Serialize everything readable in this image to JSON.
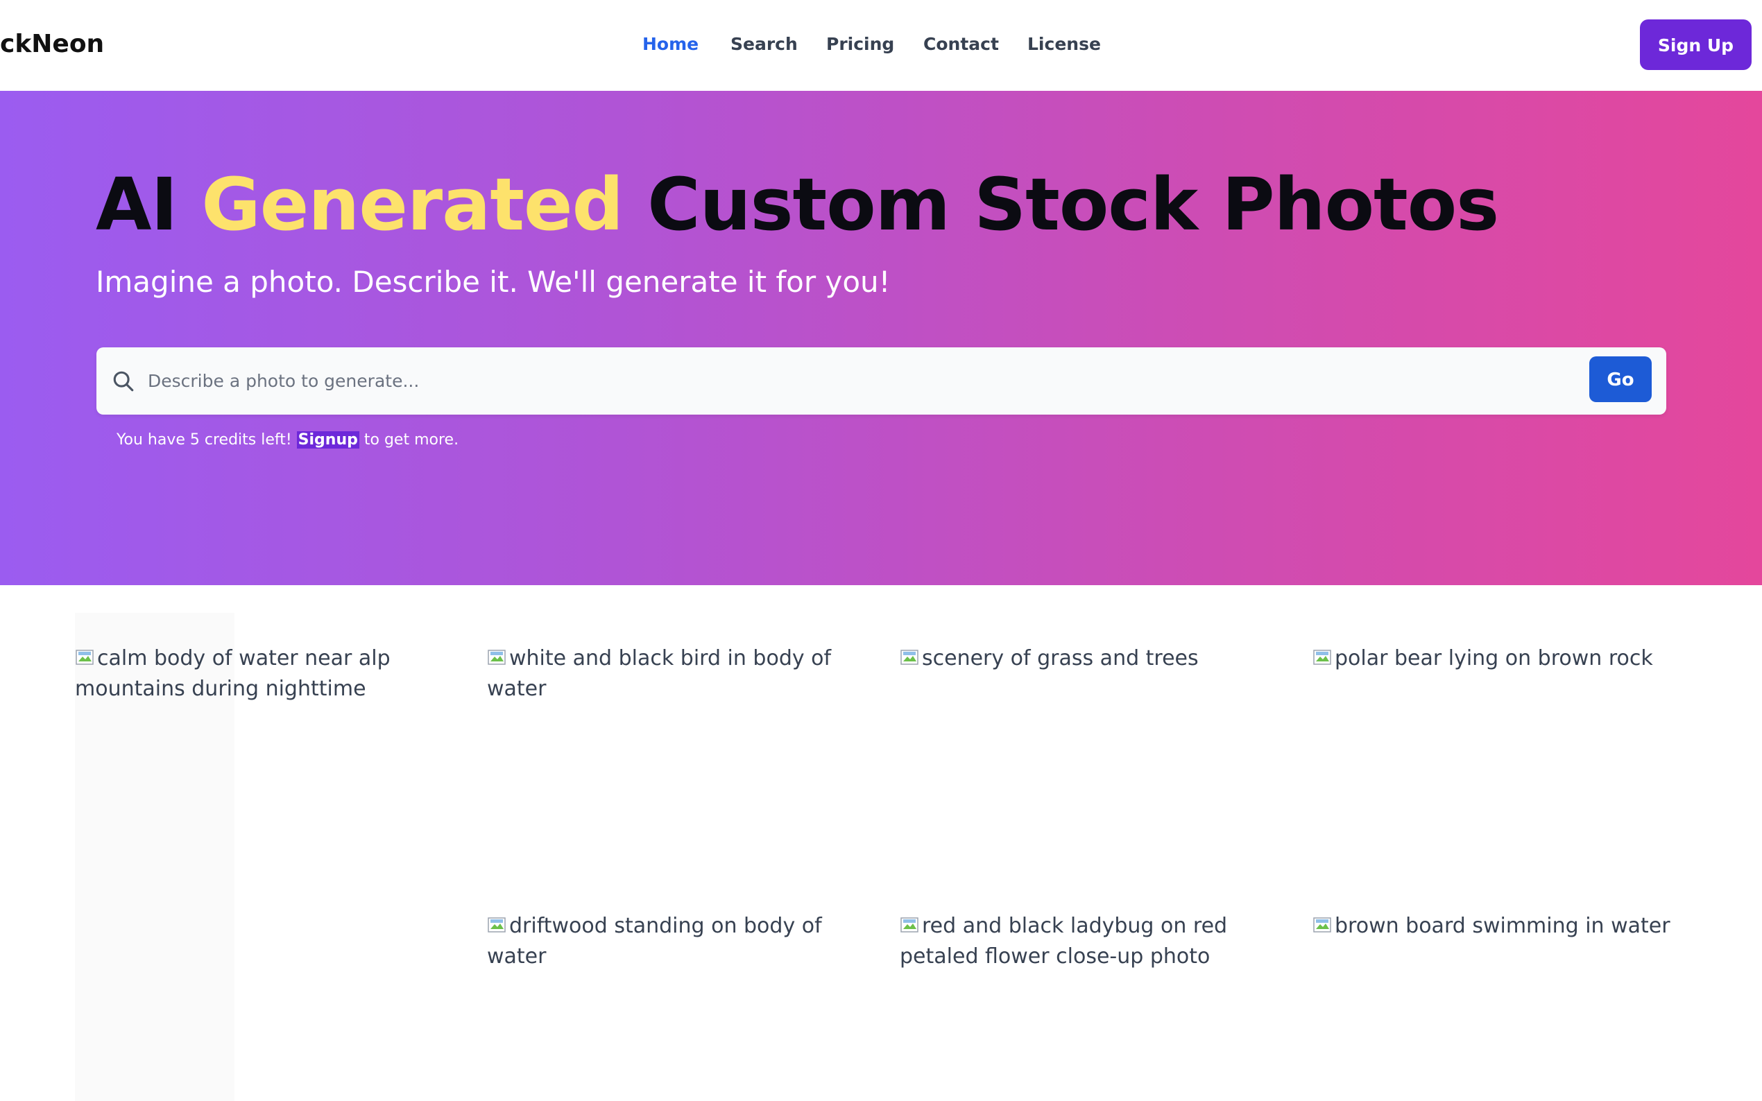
{
  "header": {
    "brand": "ckNeon",
    "nav": [
      {
        "label": "Home",
        "active": true
      },
      {
        "label": "Search",
        "active": false
      },
      {
        "label": "Pricing",
        "active": false
      },
      {
        "label": "Contact",
        "active": false
      },
      {
        "label": "License",
        "active": false
      }
    ],
    "signup_label": "Sign Up"
  },
  "hero": {
    "title_part1": "AI ",
    "title_accent": "Generated",
    "title_part2": " Custom Stock Photos",
    "subtitle": "Imagine a photo. Describe it. We'll generate it for you!",
    "search": {
      "placeholder": "Describe a photo to generate...",
      "value": "",
      "go_label": "Go"
    },
    "credits": {
      "prefix": "You have 5 credits left! ",
      "link": "Signup",
      "suffix": " to get more."
    }
  },
  "gallery": {
    "photos": [
      {
        "alt": "calm body of water near alp mountains during nighttime"
      },
      {
        "alt": "white and black bird in body of water"
      },
      {
        "alt": "scenery of grass and trees"
      },
      {
        "alt": "polar bear lying on brown rock"
      },
      {
        "alt": "driftwood standing on body of water"
      },
      {
        "alt": "red and black ladybug on red petaled flower close-up photo"
      },
      {
        "alt": "brown board swimming in water"
      }
    ]
  },
  "colors": {
    "accent": "#2563eb",
    "brand_purple": "#6d28d9",
    "title_highlight": "#fde26c",
    "go_button": "#1d5bd6",
    "hero_gradient_start": "#9b5cf0",
    "hero_gradient_end": "#e4479c"
  },
  "icons": {
    "search": "search-icon",
    "broken_image": "broken-image-icon"
  }
}
